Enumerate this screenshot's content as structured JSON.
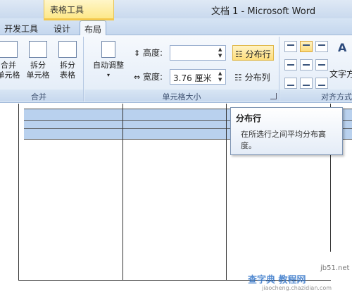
{
  "titlebar": {
    "context_tab_group": "表格工具",
    "window_title": "文档 1 - Microsoft Word"
  },
  "tabs": [
    {
      "label": "开发工具"
    },
    {
      "label": "设计"
    },
    {
      "label": "布局",
      "active": true
    }
  ],
  "ribbon": {
    "merge_group": {
      "label": "合并",
      "buttons": [
        {
          "line1": "合并",
          "line2": "单元格",
          "icon": "merge-cells-icon"
        },
        {
          "line1": "拆分",
          "line2": "单元格",
          "icon": "split-cells-icon"
        },
        {
          "line1": "拆分",
          "line2": "表格",
          "icon": "split-table-icon"
        }
      ]
    },
    "cell_size_group": {
      "label": "单元格大小",
      "autofit_label": "自动调整",
      "height_label": "高度:",
      "height_value": "",
      "width_label": "宽度:",
      "width_value": "3.76 厘米",
      "distribute_rows_label": "分布行",
      "distribute_columns_label": "分布列"
    },
    "alignment_group": {
      "label": "对齐方式",
      "text_direction_label": "文字方"
    }
  },
  "tooltip": {
    "title": "分布行",
    "body": "在所选行之间平均分布高度。"
  },
  "watermark": {
    "line1": "查字典 教程网",
    "line2": "jiaocheng.chazidian.com",
    "corner": "jb51.net"
  },
  "colors": {
    "selection": "#b9d1ee",
    "active_button": "#fddc7a",
    "ribbon_border": "#9fb8d8"
  }
}
